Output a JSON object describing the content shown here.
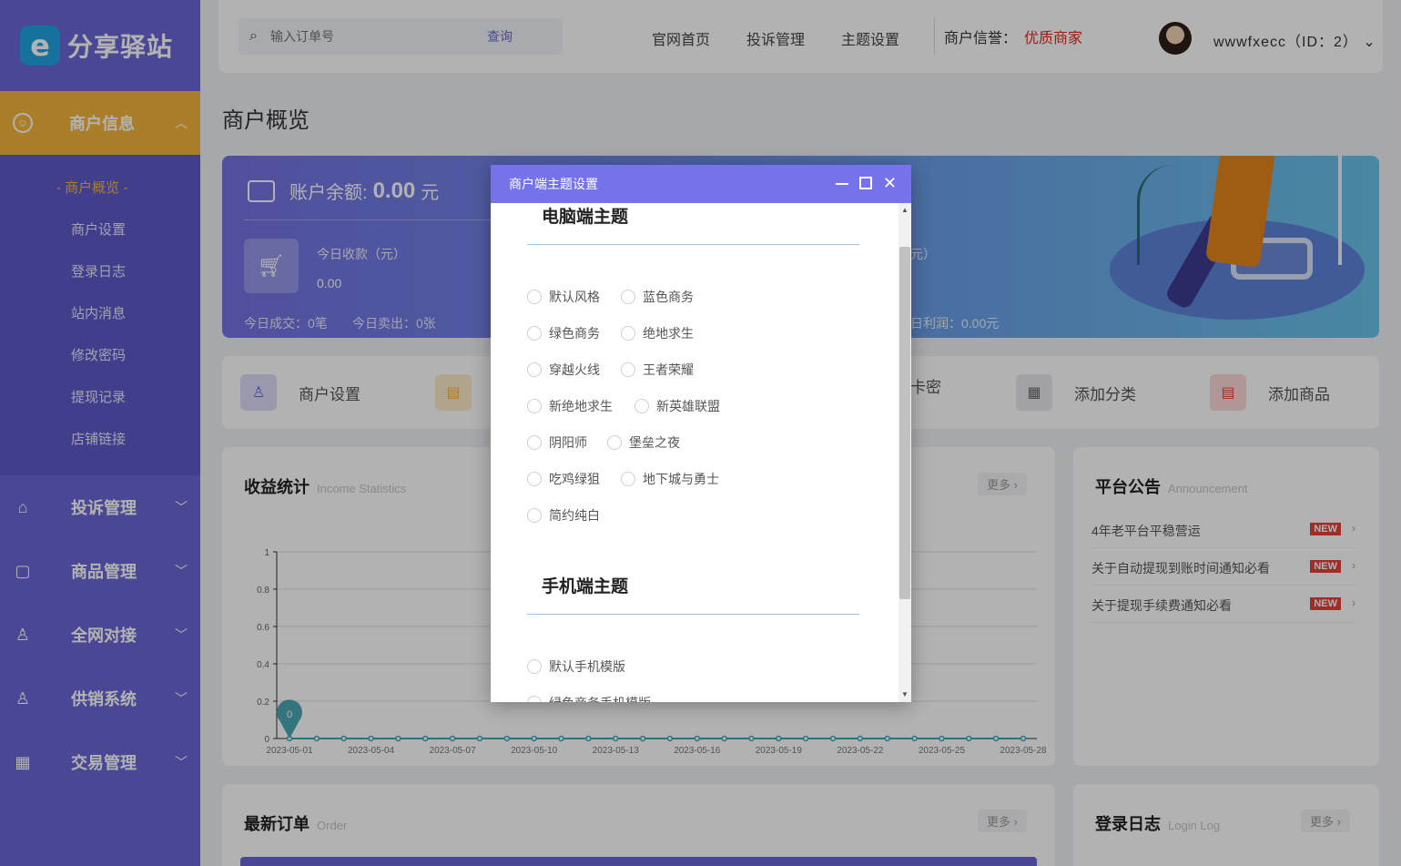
{
  "brand": {
    "logo_letter": "e",
    "name": "分享驿站"
  },
  "sidebar": {
    "active_menu": {
      "label": "商户信息"
    },
    "submenu": [
      "商户概览",
      "商户设置",
      "登录日志",
      "站内消息",
      "修改密码",
      "提现记录",
      "店铺链接"
    ],
    "menus": [
      {
        "label": "投诉管理",
        "icon": "shop-icon"
      },
      {
        "label": "商品管理",
        "icon": "bag-icon"
      },
      {
        "label": "全网对接",
        "icon": "network-icon"
      },
      {
        "label": "供销系统",
        "icon": "supply-icon"
      },
      {
        "label": "交易管理",
        "icon": "calendar-icon"
      }
    ]
  },
  "topbar": {
    "search_placeholder": "输入订单号",
    "search_button": "查询",
    "nav": [
      "官网首页",
      "投诉管理",
      "主题设置"
    ],
    "credit_label": "商户信誉：",
    "credit_value": "优质商家",
    "user": "wwwfxecc（ID：2）"
  },
  "page": {
    "title": "商户概览",
    "balance_label": "账户余额:",
    "balance_value": "0.00",
    "balance_unit": "元",
    "today_income_label": "今日收款（元）",
    "today_income_value": "0.00",
    "today_deals": "今日成交：0笔",
    "today_sold": "今日卖出：0张",
    "partial_unit": "元）",
    "today_profit": "日利润：0.00元"
  },
  "quick": [
    {
      "label": "商户设置",
      "color": "#dcdcf7",
      "icon_color": "#6a67d6"
    },
    {
      "label": "",
      "color": "#fcebc9",
      "icon_color": "#f5b73b"
    },
    {
      "label": "卡密",
      "color": "",
      "icon_color": ""
    },
    {
      "label": "添加分类",
      "color": "#e8e8ee",
      "icon_color": "#666"
    },
    {
      "label": "添加商品",
      "color": "#fcd8d8",
      "icon_color": "#e8413a"
    }
  ],
  "income_card": {
    "title": "收益统计",
    "subtitle": "Income Statistics",
    "more": "更多 ›"
  },
  "notice_card": {
    "title": "平台公告",
    "subtitle": "Announcement",
    "items": [
      {
        "text": "4年老平台平稳营运",
        "badge": "NEW"
      },
      {
        "text": "关于自动提现到账时间通知必看",
        "badge": "NEW"
      },
      {
        "text": "关于提现手续费通知必看",
        "badge": "NEW"
      }
    ]
  },
  "order_card": {
    "title": "最新订单",
    "subtitle": "Order",
    "more": "更多 ›"
  },
  "login_card": {
    "title": "登录日志",
    "subtitle": "Login Log",
    "more": "更多 ›"
  },
  "chart_data": {
    "type": "line",
    "x": [
      "2023-05-01",
      "2023-05-02",
      "2023-05-03",
      "2023-05-04",
      "2023-05-05",
      "2023-05-06",
      "2023-05-07",
      "2023-05-08",
      "2023-05-09",
      "2023-05-10",
      "2023-05-11",
      "2023-05-12",
      "2023-05-13",
      "2023-05-14",
      "2023-05-15",
      "2023-05-16",
      "2023-05-17",
      "2023-05-18",
      "2023-05-19",
      "2023-05-20",
      "2023-05-21",
      "2023-05-22",
      "2023-05-23",
      "2023-05-24",
      "2023-05-25",
      "2023-05-26",
      "2023-05-27",
      "2023-05-28"
    ],
    "x_tick_labels": [
      "2023-05-01",
      "2023-05-04",
      "2023-05-07",
      "2023-05-10",
      "2023-05-13",
      "2023-05-16",
      "2023-05-19",
      "2023-05-22",
      "2023-05-25",
      "2023-05-28"
    ],
    "series": [
      {
        "values": [
          0,
          0,
          0,
          0,
          0,
          0,
          0,
          0,
          0,
          0,
          0,
          0,
          0,
          0,
          0,
          0,
          0,
          0,
          0,
          0,
          0,
          0,
          0,
          0,
          0,
          0,
          0,
          0
        ]
      }
    ],
    "y_ticks": [
      "0",
      "0.2",
      "0.4",
      "0.6",
      "0.8",
      "1"
    ],
    "ylim": [
      0,
      1
    ],
    "grid": true,
    "annotation": "0",
    "line_color": "#3da6b8"
  },
  "modal": {
    "title": "商户端主题设置",
    "pc_section": "电脑端主题",
    "pc_themes": [
      [
        "默认风格",
        "蓝色商务"
      ],
      [
        "绿色商务",
        "绝地求生"
      ],
      [
        "穿越火线",
        "王者荣耀"
      ],
      [
        "新绝地求生",
        "新英雄联盟"
      ],
      [
        "阴阳师",
        "堡垒之夜"
      ],
      [
        "吃鸡绿狙",
        "地下城与勇士"
      ],
      [
        "简约纯白"
      ]
    ],
    "mobile_section": "手机端主题",
    "mobile_themes": [
      "默认手机模版",
      "绿色商务手机模版"
    ]
  }
}
